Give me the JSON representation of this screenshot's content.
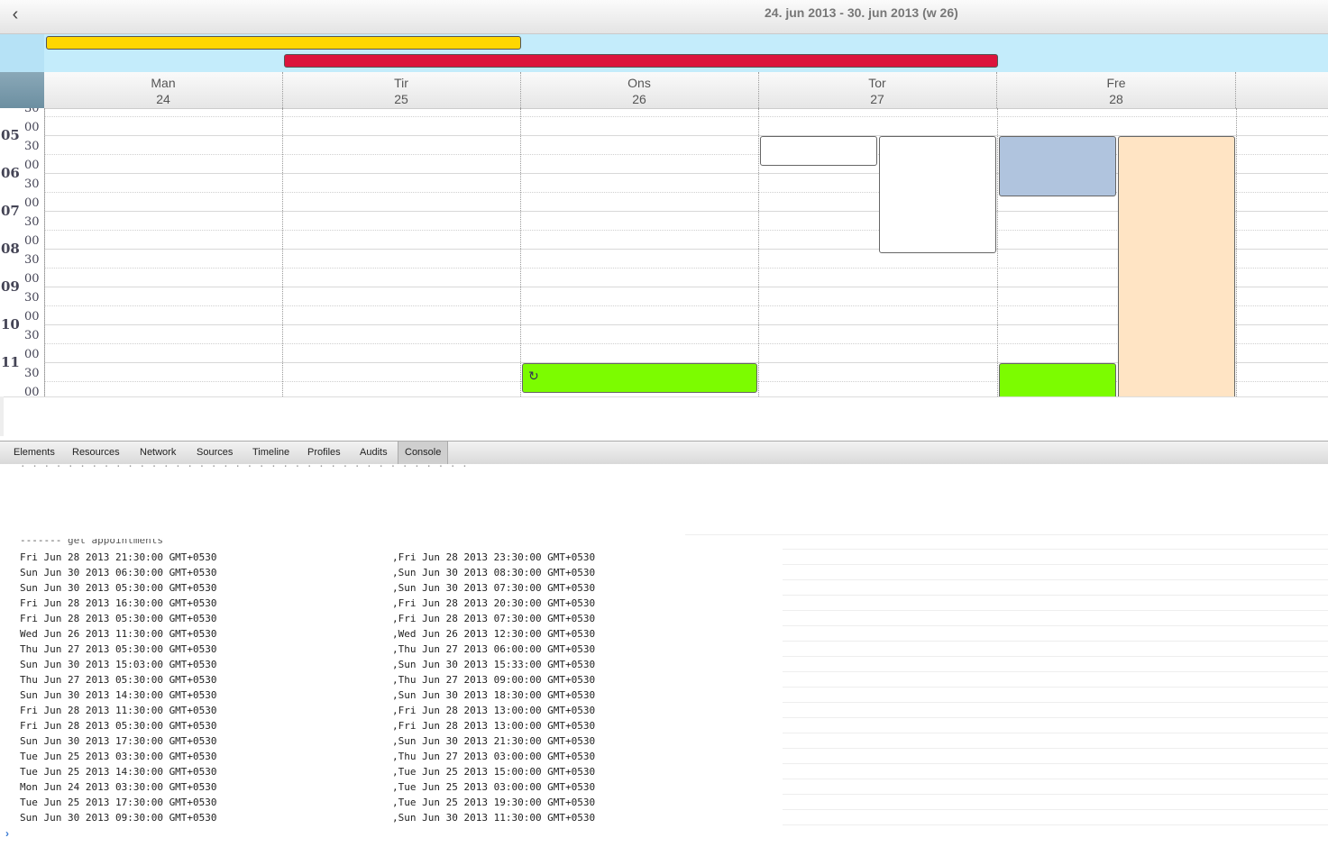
{
  "header": {
    "back_icon": "chevron-left-icon",
    "title": "24. jun 2013 - 30. jun 2013 (w 26)"
  },
  "allday_events": [
    {
      "color": "#ffd700"
    },
    {
      "color": "#dc143c"
    }
  ],
  "days": [
    {
      "name": "Man",
      "num": "24"
    },
    {
      "name": "Tir",
      "num": "25"
    },
    {
      "name": "Ons",
      "num": "26"
    },
    {
      "name": "Tor",
      "num": "27"
    },
    {
      "name": "Fre",
      "num": "28"
    }
  ],
  "hours": [
    "05",
    "06",
    "07",
    "08",
    "09",
    "10",
    "11"
  ],
  "minute_marks": [
    "30",
    "00",
    "30",
    "00",
    "30",
    "00",
    "30",
    "00",
    "30",
    "00",
    "30",
    "00",
    "30",
    "00",
    "30",
    "00"
  ],
  "events": [
    {
      "day": "Tor",
      "color": "#ffffff"
    },
    {
      "day": "Tor",
      "color": "#ffffff"
    },
    {
      "day": "Fre",
      "color": "#b0c4de"
    },
    {
      "day": "Fre",
      "color": "#ffe4c4"
    },
    {
      "day": "Ons",
      "color": "#7cfc00",
      "icon": "recurring-icon",
      "icon_glyph": "↻"
    },
    {
      "day": "Fre",
      "color": "#7cfc00"
    }
  ],
  "devtools": {
    "tabs": [
      "Elements",
      "Resources",
      "Network",
      "Sources",
      "Timeline",
      "Profiles",
      "Audits",
      "Console"
    ],
    "active_tab": "Console"
  },
  "console": {
    "faded_top": "· · · · · · · · · · · · · · · · · · · · · · · · · · · · · · · · · · · · · ·",
    "faded_header": "------- get appointments",
    "rows": [
      [
        "Fri Jun 28 2013 21:30:00 GMT+0530",
        ",Fri Jun 28 2013 23:30:00 GMT+0530"
      ],
      [
        "Sun Jun 30 2013 06:30:00 GMT+0530",
        ",Sun Jun 30 2013 08:30:00 GMT+0530"
      ],
      [
        "Sun Jun 30 2013 05:30:00 GMT+0530",
        ",Sun Jun 30 2013 07:30:00 GMT+0530"
      ],
      [
        "Fri Jun 28 2013 16:30:00 GMT+0530",
        ",Fri Jun 28 2013 20:30:00 GMT+0530"
      ],
      [
        "Fri Jun 28 2013 05:30:00 GMT+0530",
        ",Fri Jun 28 2013 07:30:00 GMT+0530"
      ],
      [
        "Wed Jun 26 2013 11:30:00 GMT+0530",
        ",Wed Jun 26 2013 12:30:00 GMT+0530"
      ],
      [
        "Thu Jun 27 2013 05:30:00 GMT+0530",
        ",Thu Jun 27 2013 06:00:00 GMT+0530"
      ],
      [
        "Sun Jun 30 2013 15:03:00 GMT+0530",
        ",Sun Jun 30 2013 15:33:00 GMT+0530"
      ],
      [
        "Thu Jun 27 2013 05:30:00 GMT+0530",
        ",Thu Jun 27 2013 09:00:00 GMT+0530"
      ],
      [
        "Sun Jun 30 2013 14:30:00 GMT+0530",
        ",Sun Jun 30 2013 18:30:00 GMT+0530"
      ],
      [
        "Fri Jun 28 2013 11:30:00 GMT+0530",
        ",Fri Jun 28 2013 13:00:00 GMT+0530"
      ],
      [
        "Fri Jun 28 2013 05:30:00 GMT+0530",
        ",Fri Jun 28 2013 13:00:00 GMT+0530"
      ],
      [
        "Sun Jun 30 2013 17:30:00 GMT+0530",
        ",Sun Jun 30 2013 21:30:00 GMT+0530"
      ],
      [
        "Tue Jun 25 2013 03:30:00 GMT+0530",
        ",Thu Jun 27 2013 03:00:00 GMT+0530"
      ],
      [
        "Tue Jun 25 2013 14:30:00 GMT+0530",
        ",Tue Jun 25 2013 15:00:00 GMT+0530"
      ],
      [
        "Mon Jun 24 2013 03:30:00 GMT+0530",
        ",Tue Jun 25 2013 03:00:00 GMT+0530"
      ],
      [
        "Tue Jun 25 2013 17:30:00 GMT+0530",
        ",Tue Jun 25 2013 19:30:00 GMT+0530"
      ],
      [
        "Sun Jun 30 2013 09:30:00 GMT+0530",
        ",Sun Jun 30 2013 11:30:00 GMT+0530"
      ]
    ],
    "prompt": "›"
  }
}
